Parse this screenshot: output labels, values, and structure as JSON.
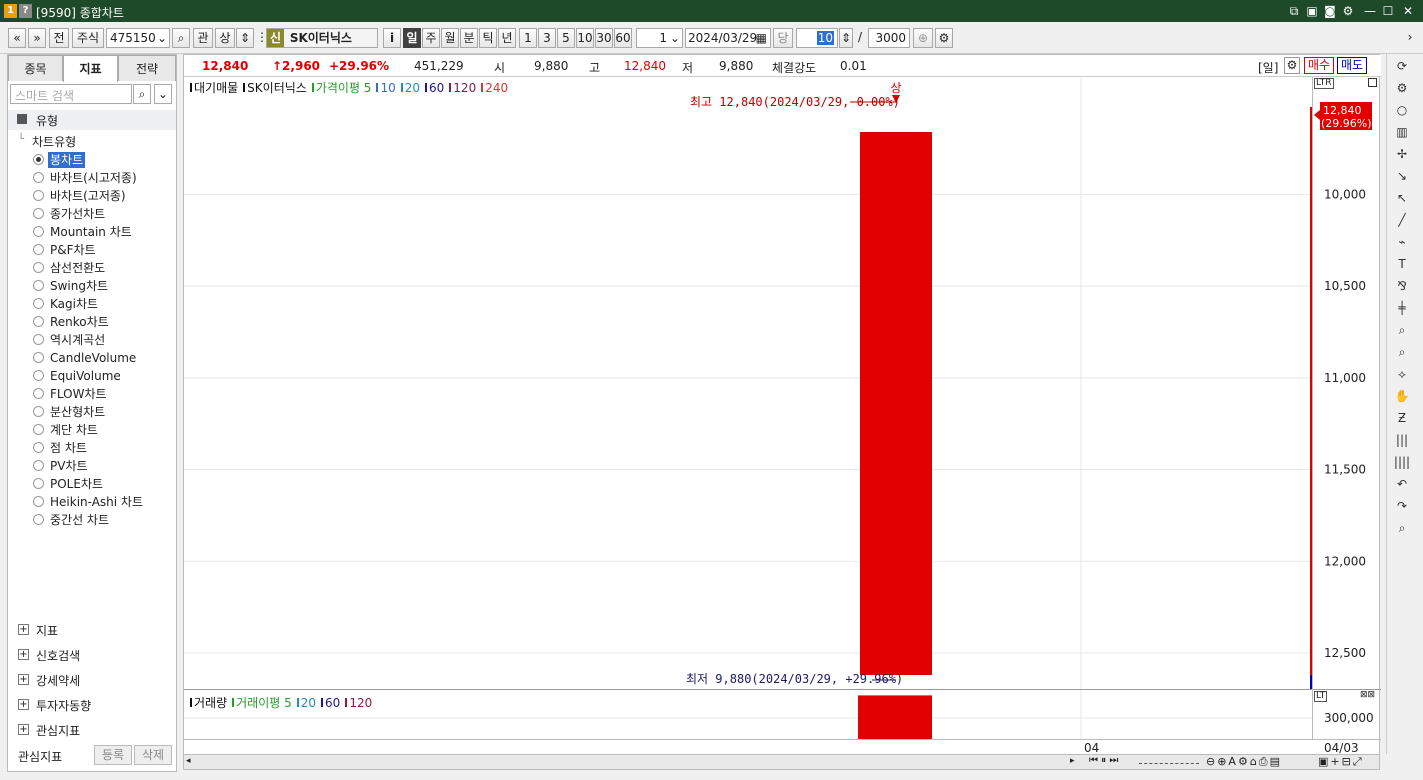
{
  "window": {
    "badge1": "1",
    "badge2": "?",
    "title": "[9590] 종합차트"
  },
  "toolbar": {
    "prev2": "«",
    "prev1": "»",
    "prefix": "전",
    "market": "주식",
    "code": "475150",
    "search_icon": "search-icon",
    "gwan": "관",
    "sang": "상",
    "sin": "신",
    "stock_name": "SK이터닉스",
    "info": "i",
    "periods": [
      "일",
      "주",
      "월",
      "분",
      "틱",
      "년"
    ],
    "intervals": [
      "1",
      "3",
      "5",
      "10",
      "30",
      "60"
    ],
    "interval_value": "1",
    "date": "2024/03/29",
    "dang": "당",
    "count": "10",
    "total": "3000",
    "slash": "/"
  },
  "left": {
    "tabs": [
      "종목",
      "지표",
      "전략"
    ],
    "search_placeholder": "스마트 검색",
    "type_header": "유형",
    "chart_type_label": "차트유형",
    "chart_types": [
      "봉차트",
      "바차트(시고저종)",
      "바차트(고저종)",
      "종가선차트",
      "Mountain 차트",
      "P&F차트",
      "삼선전환도",
      "Swing차트",
      "Kagi차트",
      "Renko차트",
      "역시계곡선",
      "CandleVolume",
      "EquiVolume",
      "FLOW차트",
      "분산형차트",
      "계단 차트",
      "점 차트",
      "PV차트",
      "POLE차트",
      "Heikin-Ashi 차트",
      "중간선 차트"
    ],
    "selected_type": "봉차트",
    "sections": [
      "지표",
      "신호검색",
      "강세약세",
      "투자자동향",
      "관심지표"
    ],
    "bottom_label": "관심지표",
    "register": "등록",
    "delete": "삭제"
  },
  "info": {
    "price": "12,840",
    "change": "↑2,960",
    "change_pct": "+29.96%",
    "volume": "451,229",
    "open_label": "시",
    "open": "9,880",
    "high_label": "고",
    "high": "12,840",
    "low_label": "저",
    "low": "9,880",
    "strength_label": "체결강도",
    "strength": "0.01",
    "period_tag": "[일]",
    "buy": "매수",
    "sell": "매도"
  },
  "legend": {
    "items": [
      "대기매물",
      "SK이터닉스",
      "가격이평 5",
      "10",
      "20",
      "60",
      "120",
      "240"
    ],
    "vol_items": [
      "거래량",
      "거래이평 5",
      "20",
      "60",
      "120"
    ]
  },
  "annotations": {
    "limit_up": "상",
    "high_note": "최고 12,840(2024/03/29, 0.00%)",
    "low_note": "최저 9,880(2024/03/29, +29.96%)",
    "price_tag": "12,840",
    "price_tag_pct": "(29.96%)"
  },
  "axis": {
    "y_ticks": [
      "12,500",
      "12,000",
      "11,500",
      "11,000",
      "10,500",
      "10,000"
    ],
    "vol_tick": "300,000",
    "x_tick": "04",
    "date_label": "04/03"
  },
  "colors": {
    "up": "#e00000",
    "down": "#0000c0",
    "title_bg": "#1f4a2a"
  },
  "chart_data": {
    "type": "bar",
    "categories": [
      "2024/03/29"
    ],
    "series": [
      {
        "name": "SK이터닉스",
        "open": 9880,
        "high": 12840,
        "low": 9880,
        "close": 12840
      }
    ],
    "volume": [
      451229
    ],
    "ylim": [
      9880,
      12840
    ],
    "y_ticks": [
      10000,
      10500,
      11000,
      11500,
      12000,
      12500
    ]
  }
}
